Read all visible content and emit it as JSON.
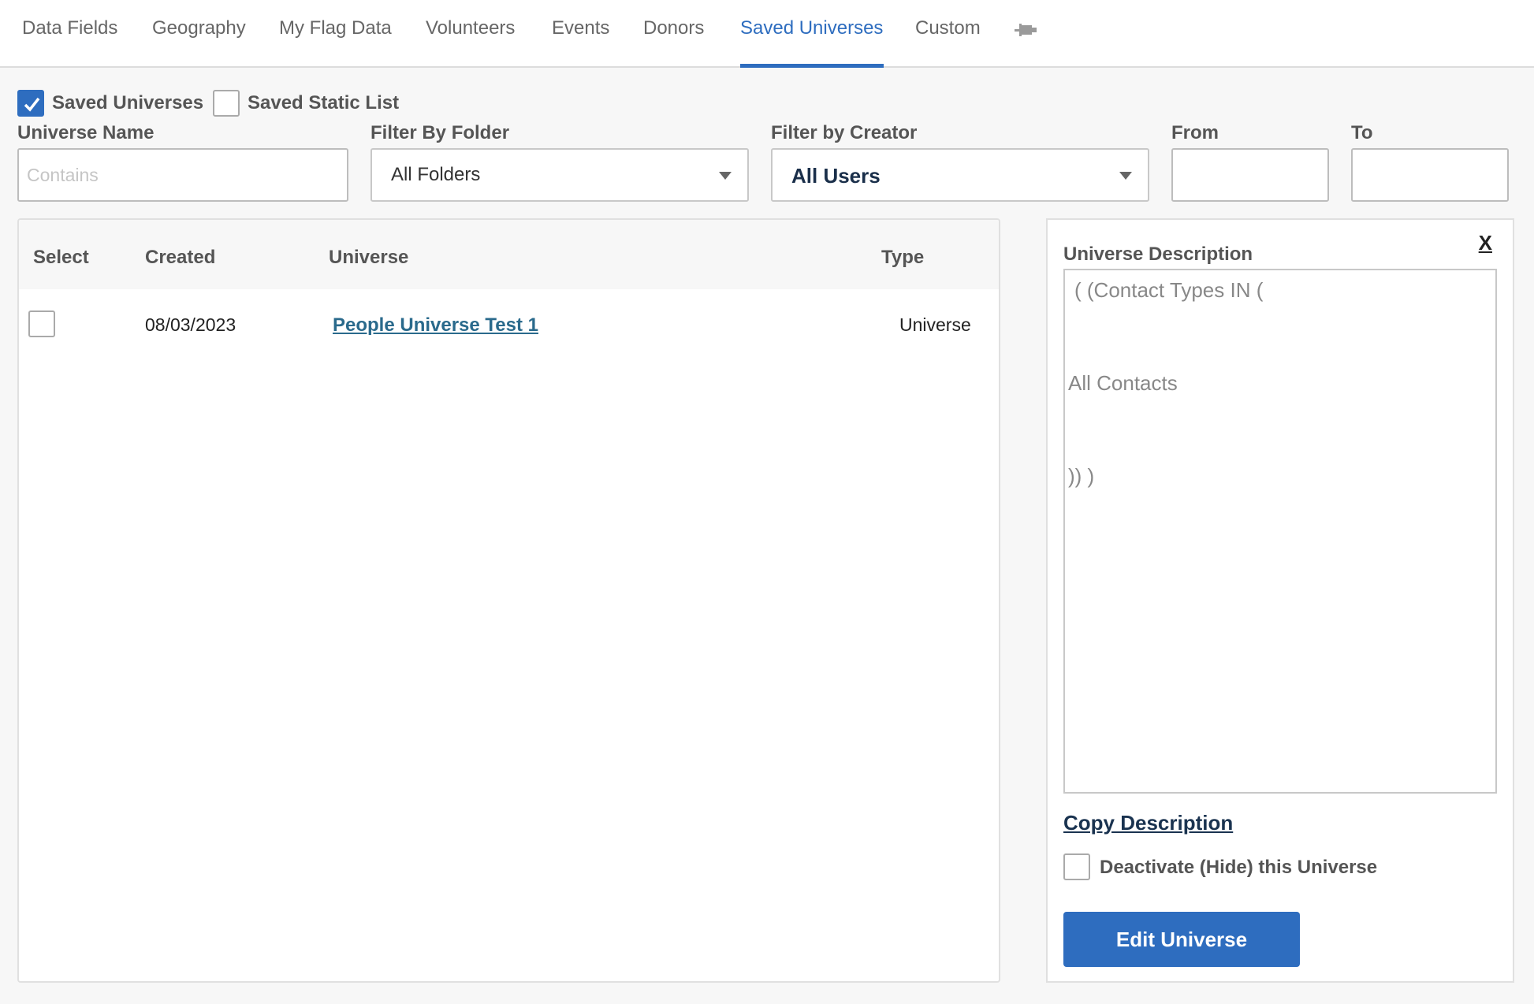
{
  "tabs": [
    {
      "label": "Data Fields"
    },
    {
      "label": "Geography"
    },
    {
      "label": "My Flag Data"
    },
    {
      "label": "Volunteers"
    },
    {
      "label": "Events"
    },
    {
      "label": "Donors"
    },
    {
      "label": "Saved Universes",
      "active": true
    },
    {
      "label": "Custom"
    }
  ],
  "pin_icon": "pin-icon",
  "filters": {
    "saved_universes_label": "Saved Universes",
    "saved_universes_checked": true,
    "saved_static_list_label": "Saved Static List",
    "saved_static_list_checked": false,
    "universe_name_label": "Universe Name",
    "universe_name_placeholder": "Contains",
    "universe_name_value": "",
    "folder_label": "Filter By Folder",
    "folder_value": "All Folders",
    "creator_label": "Filter by Creator",
    "creator_value": "All Users",
    "from_label": "From",
    "from_value": "",
    "to_label": "To",
    "to_value": ""
  },
  "table": {
    "headers": {
      "select": "Select",
      "created": "Created",
      "universe": "Universe",
      "type": "Type"
    },
    "rows": [
      {
        "selected": false,
        "created": "08/03/2023",
        "universe": "People Universe Test 1",
        "type": "Universe"
      }
    ]
  },
  "description_panel": {
    "close_label": "X",
    "title": "Universe Description",
    "lines": [
      "( (Contact Types IN (",
      "All Contacts",
      ")) )"
    ],
    "copy_label": "Copy Description",
    "deactivate_label": "Deactivate (Hide) this Universe",
    "deactivate_checked": false,
    "edit_button_label": "Edit Universe"
  },
  "colors": {
    "accent": "#2e6dbf",
    "link": "#2a6a8c"
  }
}
